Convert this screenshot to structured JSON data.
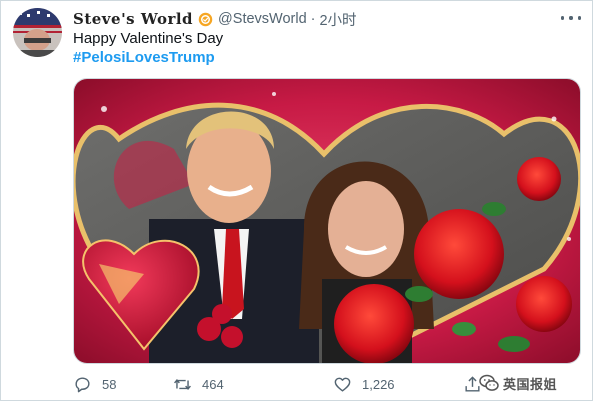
{
  "tweet": {
    "display_name": "Steve's World",
    "handle": "@StevsWorld",
    "separator": "·",
    "time": "2小时",
    "text": "Happy Valentine's Day",
    "hashtag": "#PelosiLovesTrump"
  },
  "actions": {
    "reply_count": "58",
    "retweet_count": "464",
    "like_count": "1,226"
  },
  "watermark": {
    "text": "英国报姐"
  },
  "icons": {
    "badge": "gear-badge-icon",
    "more": "more-options-icon",
    "reply": "reply-icon",
    "retweet": "retweet-icon",
    "like": "heart-icon",
    "share": "share-icon"
  },
  "colors": {
    "accent": "#1d9bf0",
    "secondary_text": "#536471",
    "badge": "#f6a623"
  }
}
